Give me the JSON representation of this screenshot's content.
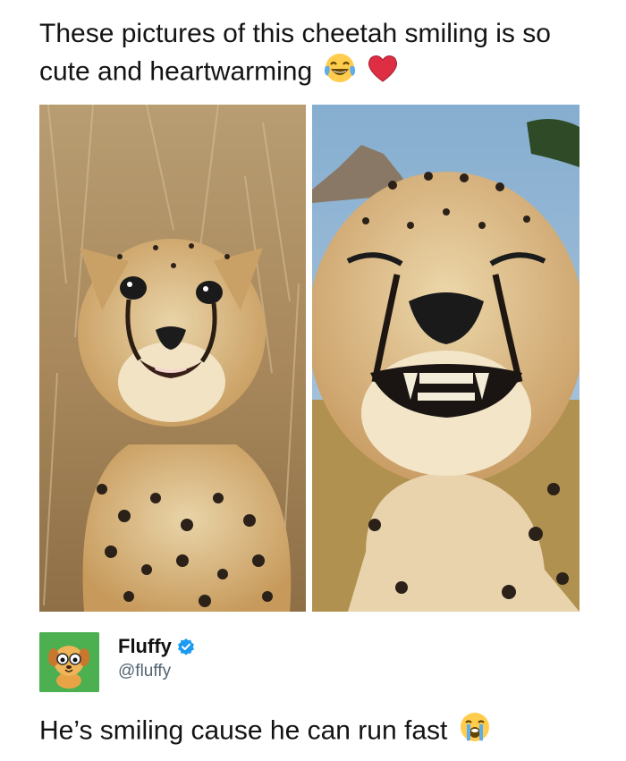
{
  "post": {
    "text": "These pictures of this cheetah smiling is so cute and heartwarming",
    "emojis": [
      "laughing-crying-emoji",
      "red-heart-emoji"
    ]
  },
  "photos": [
    {
      "name": "smiling-cheetah-cub",
      "icon": "cheetah-photo"
    },
    {
      "name": "grinning-cheetah-closeup",
      "icon": "cheetah-photo"
    }
  ],
  "account": {
    "display_name": "Fluffy",
    "handle": "@fluffy",
    "verified": true,
    "avatar_icon": "cartoon-dog-avatar"
  },
  "reply": {
    "text": "He’s smiling cause he can run fast",
    "emoji": "loudly-crying-emoji"
  },
  "colors": {
    "background": "#ffffff",
    "text": "#141414",
    "handle": "#536471",
    "verified_badge": "#1d9bf0",
    "avatar_bg": "#4caf50"
  }
}
